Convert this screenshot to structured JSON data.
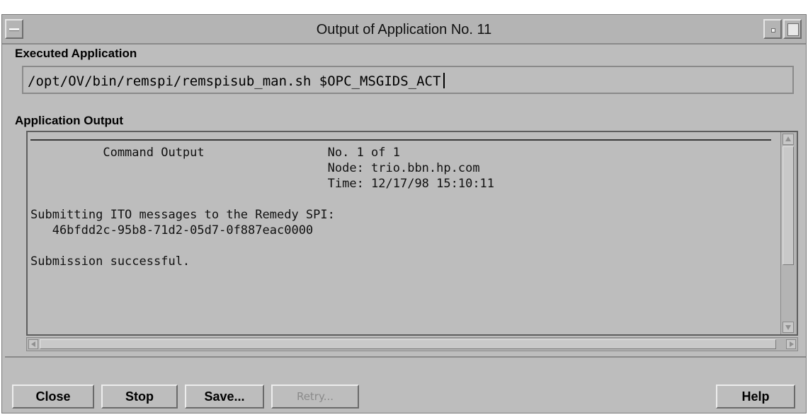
{
  "window": {
    "title": "Output of Application No. 11"
  },
  "executed": {
    "label": "Executed Application",
    "command": "/opt/OV/bin/remspi/remspisub_man.sh $OPC_MSGIDS_ACT"
  },
  "output": {
    "label": "Application Output",
    "lines": [
      "          Command Output                 No. 1 of 1",
      "                                         Node: trio.bbn.hp.com",
      "                                         Time: 12/17/98 15:10:11",
      "",
      "Submitting ITO messages to the Remedy SPI:",
      "   46bfdd2c-95b8-71d2-05d7-0f887eac0000",
      "",
      "Submission successful."
    ]
  },
  "buttons": {
    "close": "Close",
    "stop": "Stop",
    "save": "Save...",
    "retry": "Retry...",
    "help": "Help"
  }
}
